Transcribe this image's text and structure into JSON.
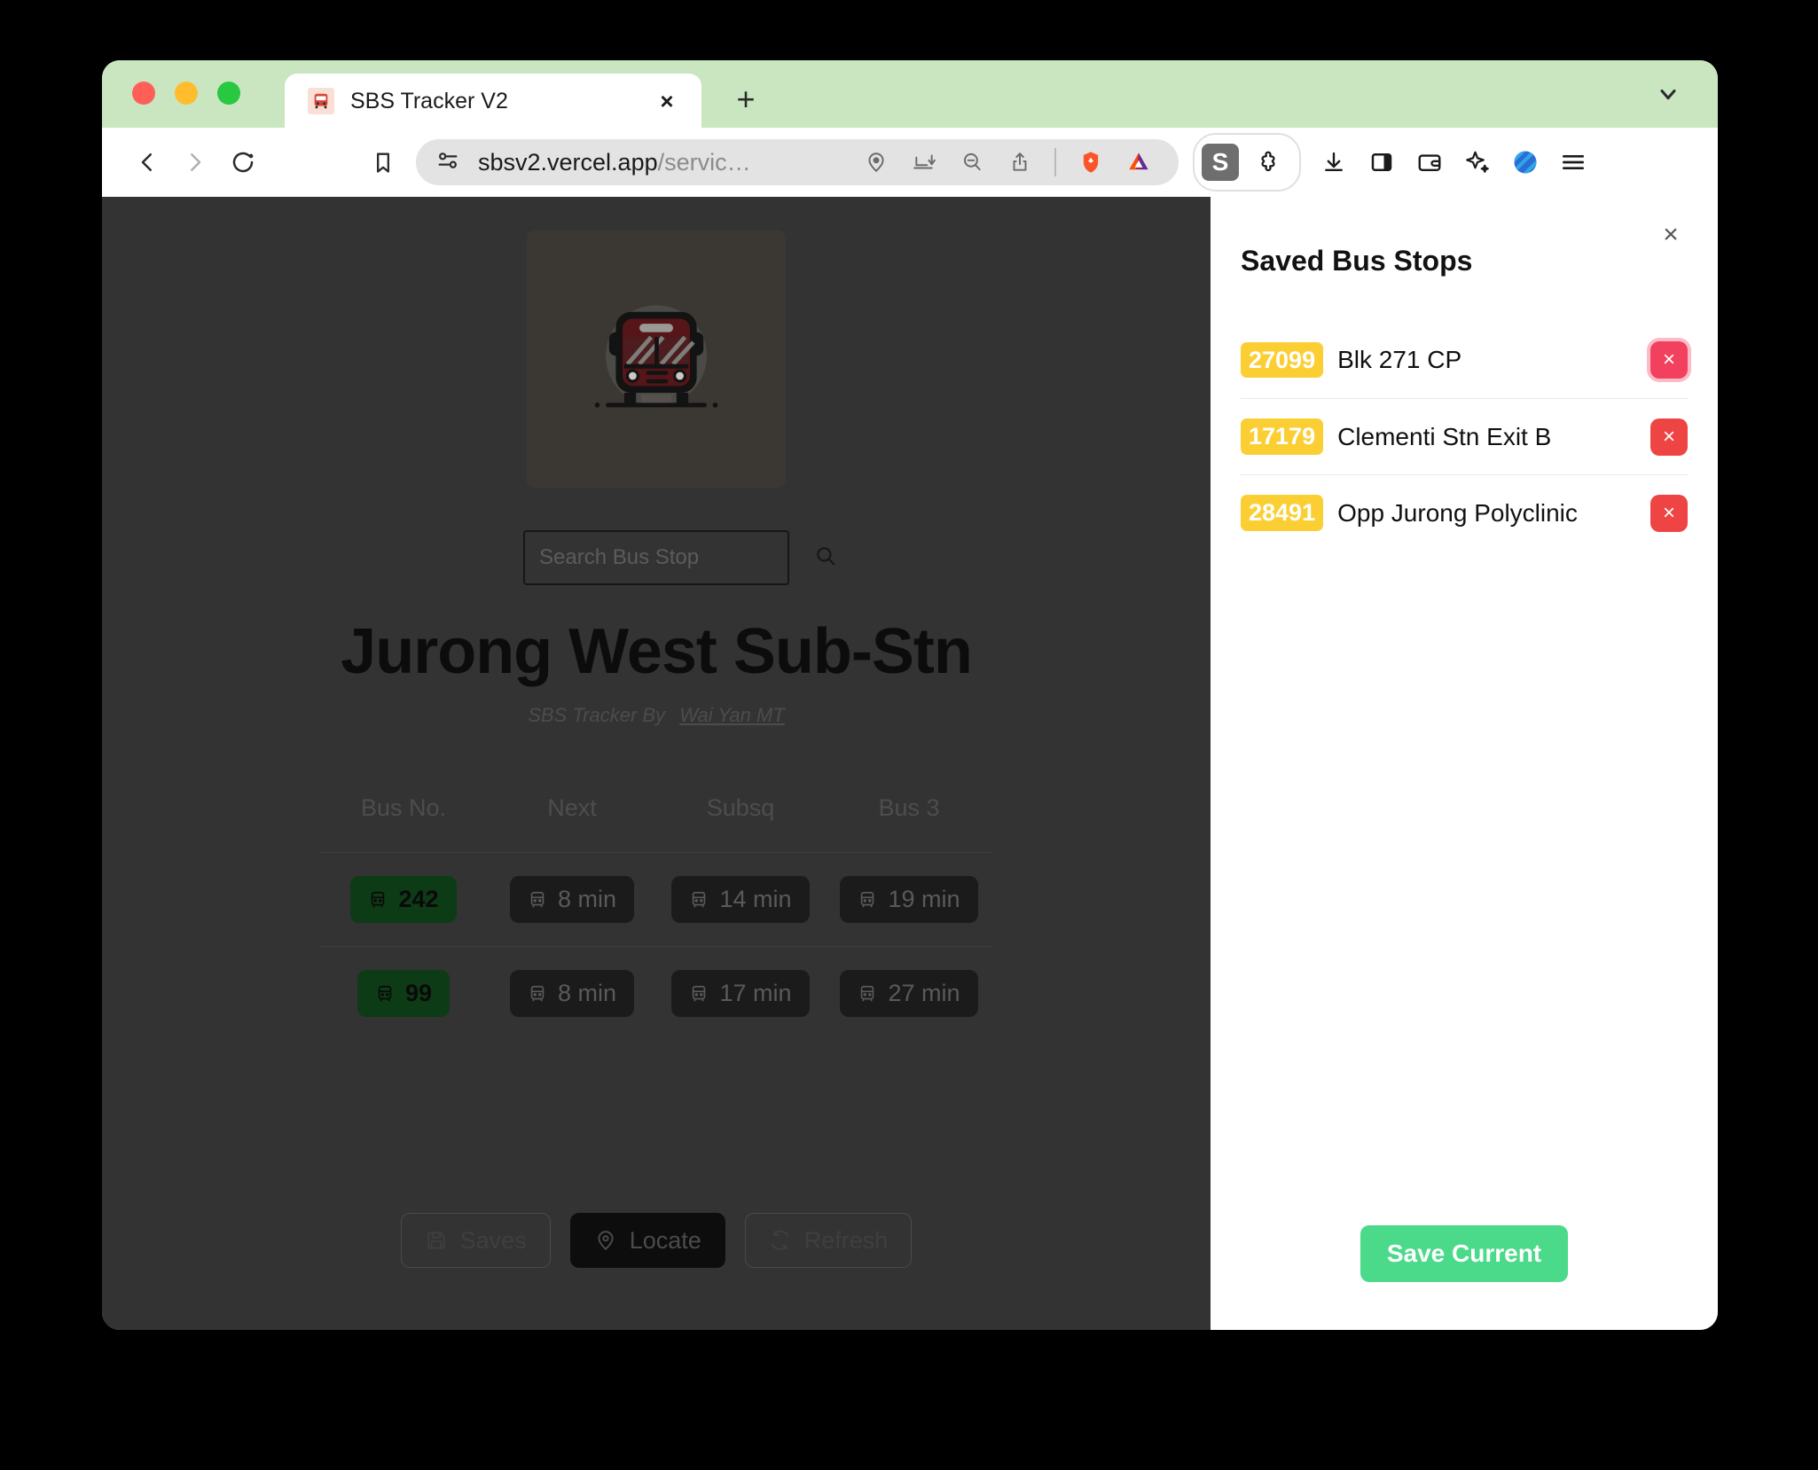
{
  "browser": {
    "tab": {
      "title": "SBS Tracker V2",
      "favicon": "bus-favicon",
      "close_label": "×"
    },
    "new_tab_label": "+",
    "address": {
      "host": "sbsv2.vercel.app",
      "path": "/servic…"
    },
    "toolbar_icons": [
      "back-icon",
      "forward-icon",
      "reload-icon",
      "bookmark-icon",
      "site-settings-icon",
      "location-pin-icon",
      "save-page-icon",
      "zoom-out-icon",
      "share-icon",
      "brave-shields-icon",
      "bat-rewards-icon",
      "extension-s-icon",
      "extensions-puzzle-icon",
      "downloads-icon",
      "sidebar-toggle-icon",
      "wallet-icon",
      "leo-ai-icon",
      "sync-logo-icon",
      "hamburger-menu-icon"
    ]
  },
  "page": {
    "logo_alt": "bus-logo",
    "search": {
      "placeholder": "Search Bus Stop",
      "value": ""
    },
    "stop_title": "Jurong West Sub-Stn",
    "byline_prefix": "SBS Tracker By",
    "byline_author": "Wai Yan MT",
    "table": {
      "headers": [
        "Bus No.",
        "Next",
        "Subsq",
        "Bus 3"
      ],
      "rows": [
        {
          "bus_no": "242",
          "next": "8 min",
          "subsq": "14 min",
          "bus3": "19 min"
        },
        {
          "bus_no": "99",
          "next": "8 min",
          "subsq": "17 min",
          "bus3": "27 min"
        }
      ]
    },
    "actions": [
      {
        "label": "Saves",
        "icon": "floppy-disk-icon",
        "style": "outline"
      },
      {
        "label": "Locate",
        "icon": "location-pin-icon",
        "style": "primary"
      },
      {
        "label": "Refresh",
        "icon": "refresh-icon",
        "style": "outline"
      }
    ]
  },
  "side_panel": {
    "title": "Saved Bus Stops",
    "close_label": "×",
    "rows": [
      {
        "code": "27099",
        "name": "Blk 271 CP",
        "delete_label": "×",
        "hovered": true
      },
      {
        "code": "17179",
        "name": "Clementi Stn Exit B",
        "delete_label": "×",
        "hovered": false
      },
      {
        "code": "28491",
        "name": "Opp Jurong Polyclinic",
        "delete_label": "×",
        "hovered": false
      }
    ],
    "save_button_label": "Save Current"
  },
  "colors": {
    "tabstrip_green": "#c9e6c1",
    "page_bg": "#333333",
    "badge_yellow": "#fbcf33",
    "delete_red": "#ef4444",
    "save_green": "#4bd98a",
    "bus_pill_green": "#0d3b16"
  }
}
